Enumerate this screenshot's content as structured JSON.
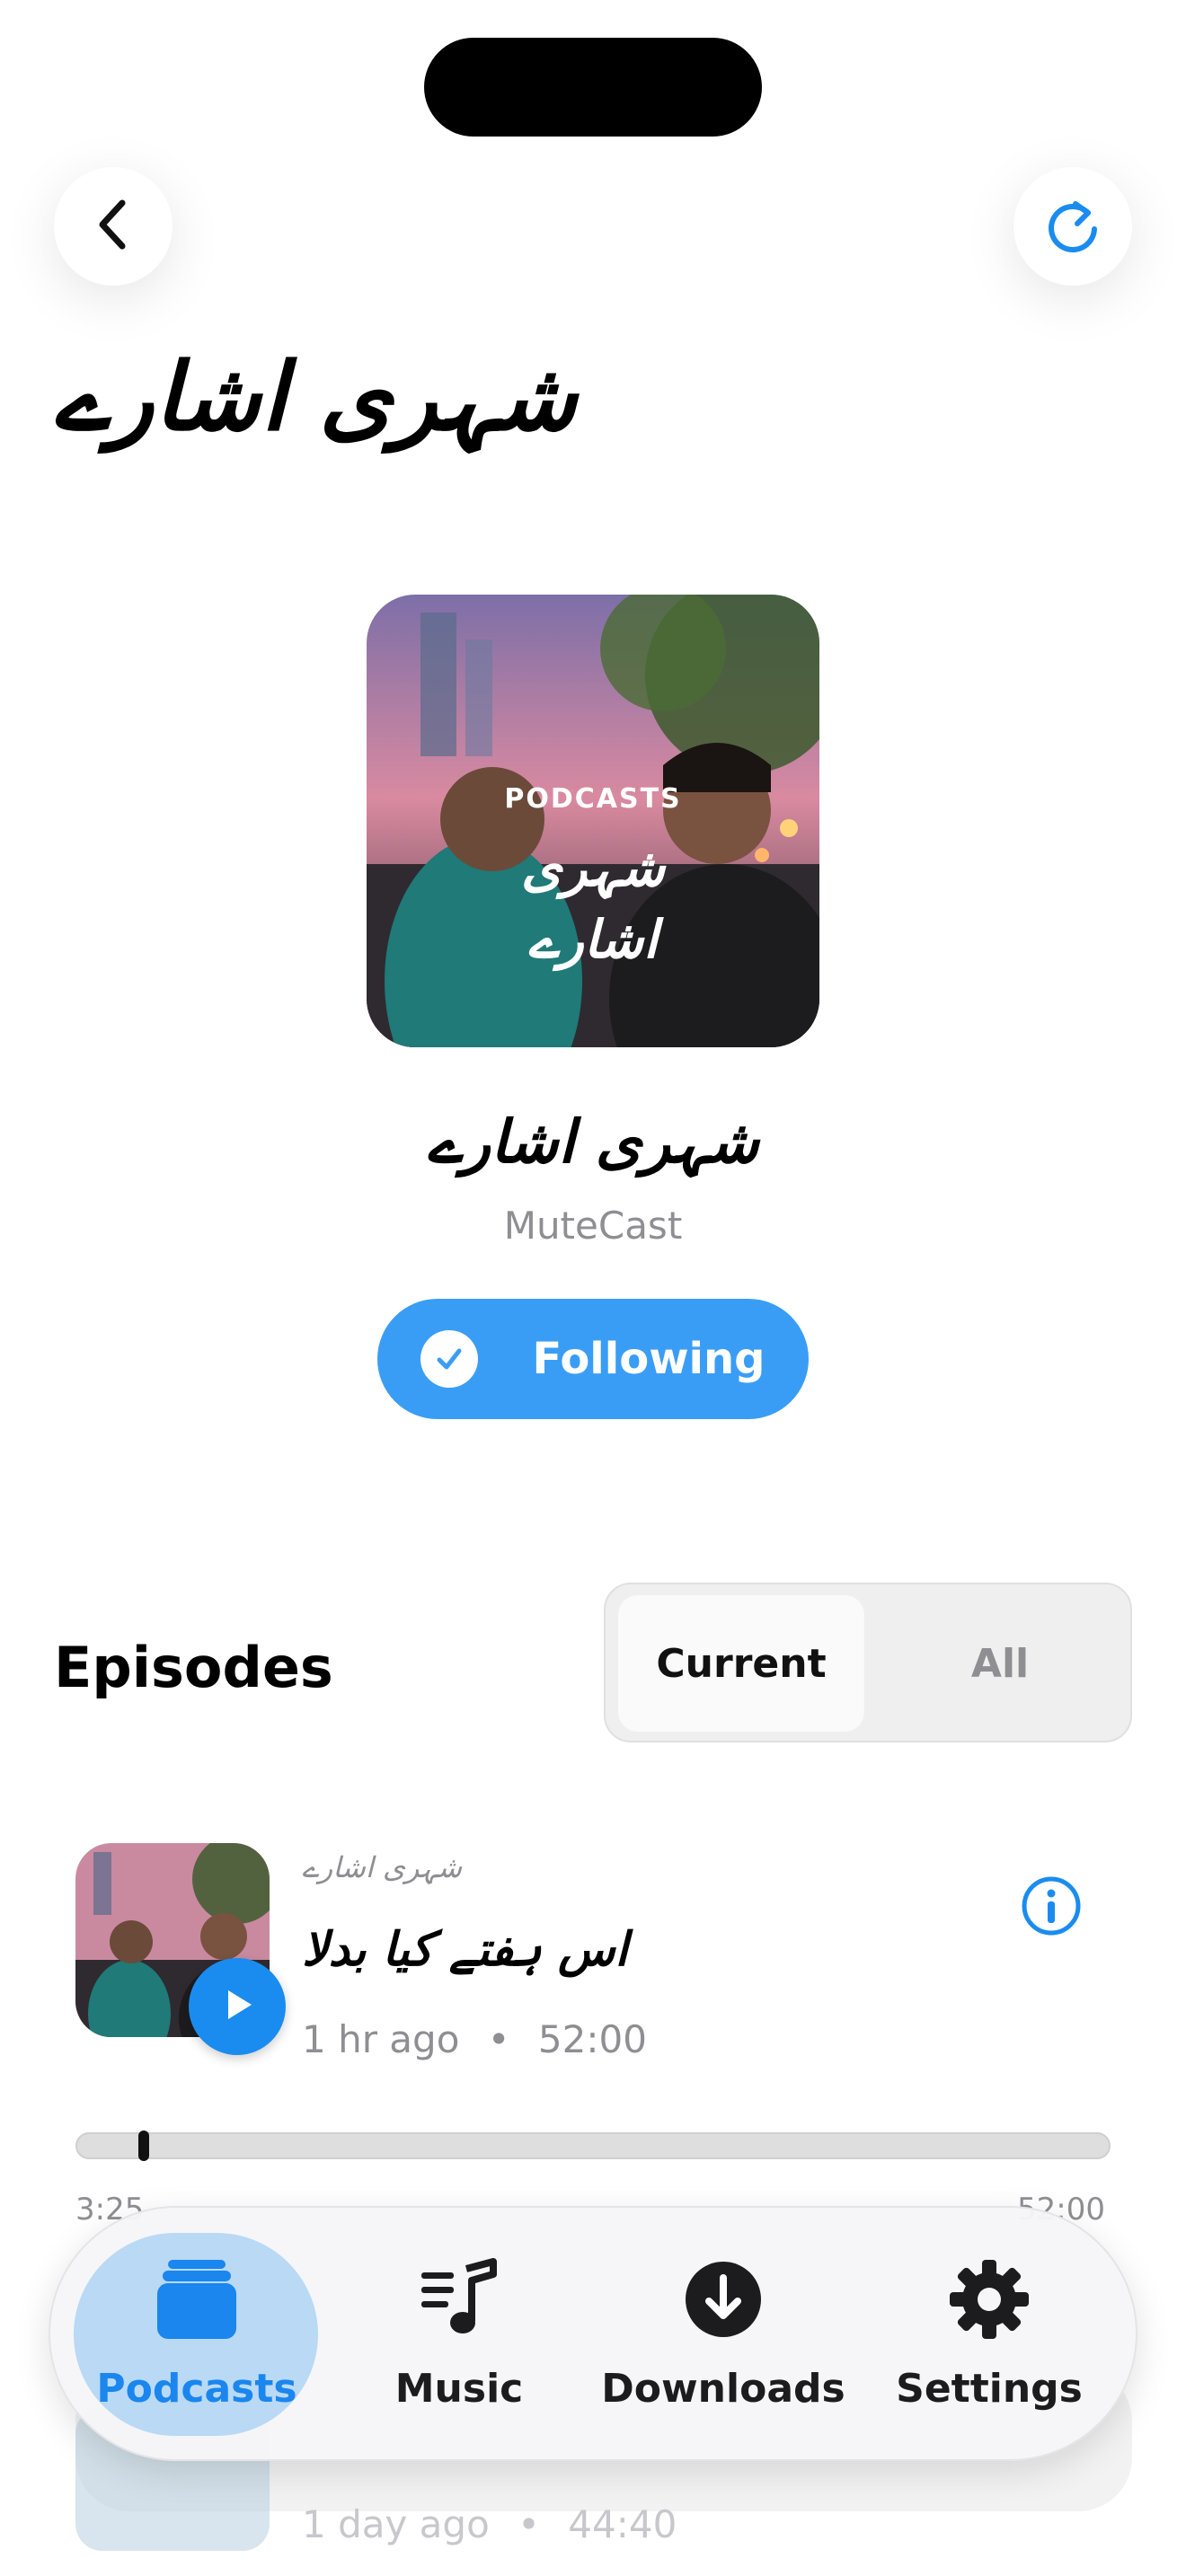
{
  "header": {
    "title": "شہری اشارے",
    "back_icon": "chevron-left-icon",
    "refresh_icon": "refresh-icon"
  },
  "podcast": {
    "cover_label": "PODCASTS",
    "cover_title_line1": "شہری",
    "cover_title_line2": "اشارے",
    "title": "شہری اشارے",
    "author": "MuteCast",
    "follow_label": "Following"
  },
  "episodes": {
    "section_title": "Episodes",
    "segments": [
      "Current",
      "All"
    ],
    "selected_segment": "Current",
    "items": [
      {
        "show": "شہری اشارے",
        "title": "اس ہفتے کیا بدلا",
        "age": "1 hr ago",
        "duration": "52:00",
        "elapsed": "3:25",
        "total": "52:00",
        "progress": 0.066
      },
      {
        "age": "1 day ago",
        "duration": "44:40"
      }
    ]
  },
  "tabbar": {
    "items": [
      {
        "label": "Podcasts",
        "icon": "podcasts-stack-icon",
        "active": true
      },
      {
        "label": "Music",
        "icon": "music-note-list-icon",
        "active": false
      },
      {
        "label": "Downloads",
        "icon": "download-circle-icon",
        "active": false
      },
      {
        "label": "Settings",
        "icon": "gear-icon",
        "active": false
      }
    ]
  },
  "colors": {
    "accent": "#1a8cf0",
    "follow_bg": "#3a9df5",
    "tab_active_bg": "#b9d9f5",
    "secondary_text": "#8e8e93"
  }
}
